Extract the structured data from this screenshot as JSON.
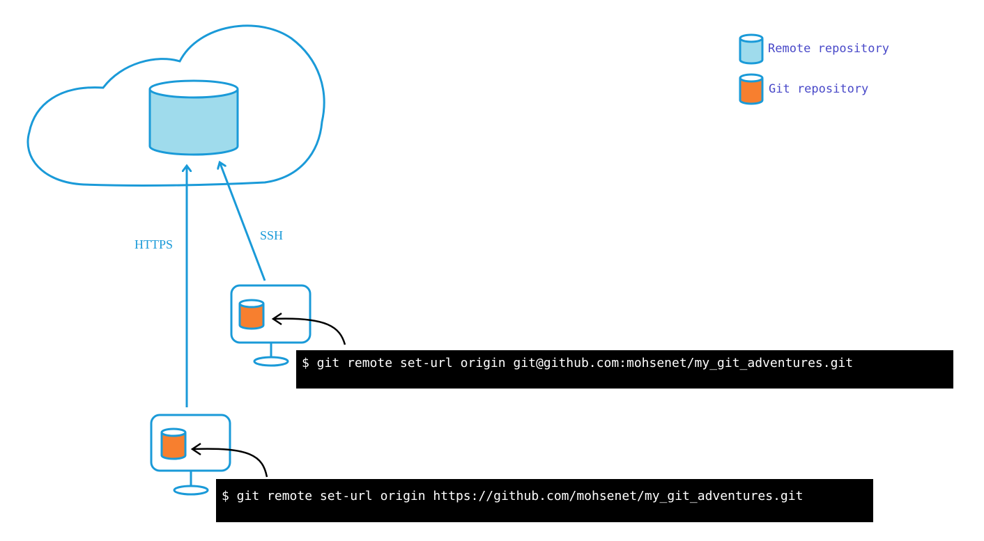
{
  "legend": {
    "remote_label": "Remote repository",
    "git_label": "Git repository"
  },
  "protocols": {
    "https_label": "HTTPS",
    "ssh_label": "SSH"
  },
  "commands": {
    "ssh_command": "$ git remote set-url origin git@github.com:mohsenet/my_git_adventures.git",
    "https_command": "$ git remote set-url origin https://github.com/mohsenet/my_git_adventures.git"
  },
  "colors": {
    "line_blue": "#1a9ad8",
    "remote_fill": "#9fdbec",
    "git_fill": "#f77f2f",
    "legend_text": "#4848c8",
    "terminal_bg": "#000000",
    "terminal_text": "#ffffff"
  }
}
